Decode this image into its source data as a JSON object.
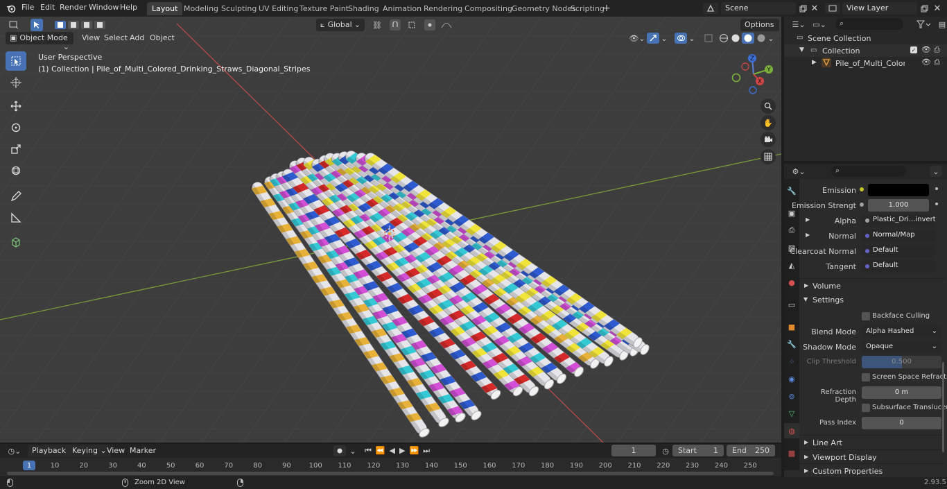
{
  "menus": [
    "File",
    "Edit",
    "Render",
    "Window",
    "Help"
  ],
  "workspaces": [
    "Layout",
    "Modeling",
    "Sculpting",
    "UV Editing",
    "Texture Paint",
    "Shading",
    "Animation",
    "Rendering",
    "Compositing",
    "Geometry Nodes",
    "Scripting"
  ],
  "scene_name": "Scene",
  "view_layer": "View Layer",
  "viewport": {
    "mode": "Object Mode",
    "menu": [
      "View",
      "Select",
      "Add",
      "Object"
    ],
    "orientation": "Global",
    "options_label": "Options",
    "perspective_label": "User Perspective",
    "collection_label": "(1) Collection | Pile_of_Multi_Colored_Drinking_Straws_Diagonal_Stripes",
    "axis_labels": {
      "z": "Z",
      "y": "Y",
      "x": "X"
    }
  },
  "outliner": {
    "scene_collection": "Scene Collection",
    "collection": "Collection",
    "object": "Pile_of_Multi_Colored_Dri"
  },
  "properties": {
    "emission_label": "Emission",
    "emission_strength_label": "Emission Strengt",
    "emission_strength_value": "1.000",
    "alpha_label": "Alpha",
    "alpha_value": "Plastic_Dri...invert.png",
    "normal_label": "Normal",
    "normal_value": "Normal/Map",
    "clearcoat_normal_label": "Clearcoat Normal",
    "clearcoat_normal_value": "Default",
    "tangent_label": "Tangent",
    "tangent_value": "Default",
    "volume_section": "Volume",
    "settings_section": "Settings",
    "backface_culling": "Backface Culling",
    "blend_mode_label": "Blend Mode",
    "blend_mode_value": "Alpha Hashed",
    "shadow_mode_label": "Shadow Mode",
    "shadow_mode_value": "Opaque",
    "clip_threshold_label": "Clip Threshold",
    "clip_threshold_value": "0.500",
    "ssr_label": "Screen Space Refraction",
    "refraction_depth_label": "Refraction Depth",
    "refraction_depth_value": "0 m",
    "sss_label": "Subsurface Translucency",
    "pass_index_label": "Pass Index",
    "pass_index_value": "0",
    "line_art_section": "Line Art",
    "viewport_display_section": "Viewport Display",
    "custom_properties_section": "Custom Properties"
  },
  "timeline": {
    "menu": [
      "Playback",
      "Keying",
      "View",
      "Marker"
    ],
    "current_frame": "1",
    "start_label": "Start",
    "start_value": "1",
    "end_label": "End",
    "end_value": "250",
    "ticks": [
      "1",
      "10",
      "20",
      "30",
      "40",
      "50",
      "60",
      "70",
      "80",
      "90",
      "100",
      "110",
      "120",
      "130",
      "140",
      "150",
      "160",
      "170",
      "180",
      "190",
      "200",
      "210",
      "220",
      "230",
      "240",
      "250"
    ]
  },
  "statusbar": {
    "hint": "Zoom 2D View",
    "version": "2.93.5"
  },
  "colors": {
    "accent": "#4772b3",
    "straw_colors": [
      "#e8b23a",
      "#35c9d6",
      "#d24fd6",
      "#2f5bd0",
      "#d62a2a",
      "#f0e33a"
    ]
  }
}
